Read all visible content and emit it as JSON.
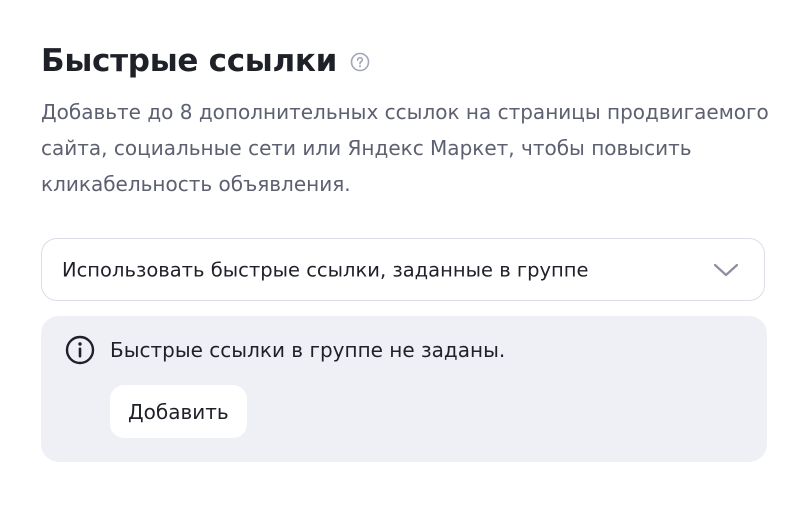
{
  "section": {
    "title": "Быстрые ссылки",
    "help_icon": "question-circle-icon",
    "description": "Добавьте до 8 дополнительных ссылок на страницы продвигаемого сайта, социальные сети или Яндекс Маркет, чтобы повысить кликабельность объявления."
  },
  "select": {
    "value": "Использовать быстрые ссылки, заданные в группе",
    "icon": "chevron-down-icon"
  },
  "info": {
    "icon": "info-circle-icon",
    "text": "Быстрые ссылки в группе не заданы.",
    "add_label": "Добавить"
  },
  "colors": {
    "title": "#1f2129",
    "description": "#5c6070",
    "panel_background": "#eff0f5",
    "border": "#dcdde8"
  }
}
